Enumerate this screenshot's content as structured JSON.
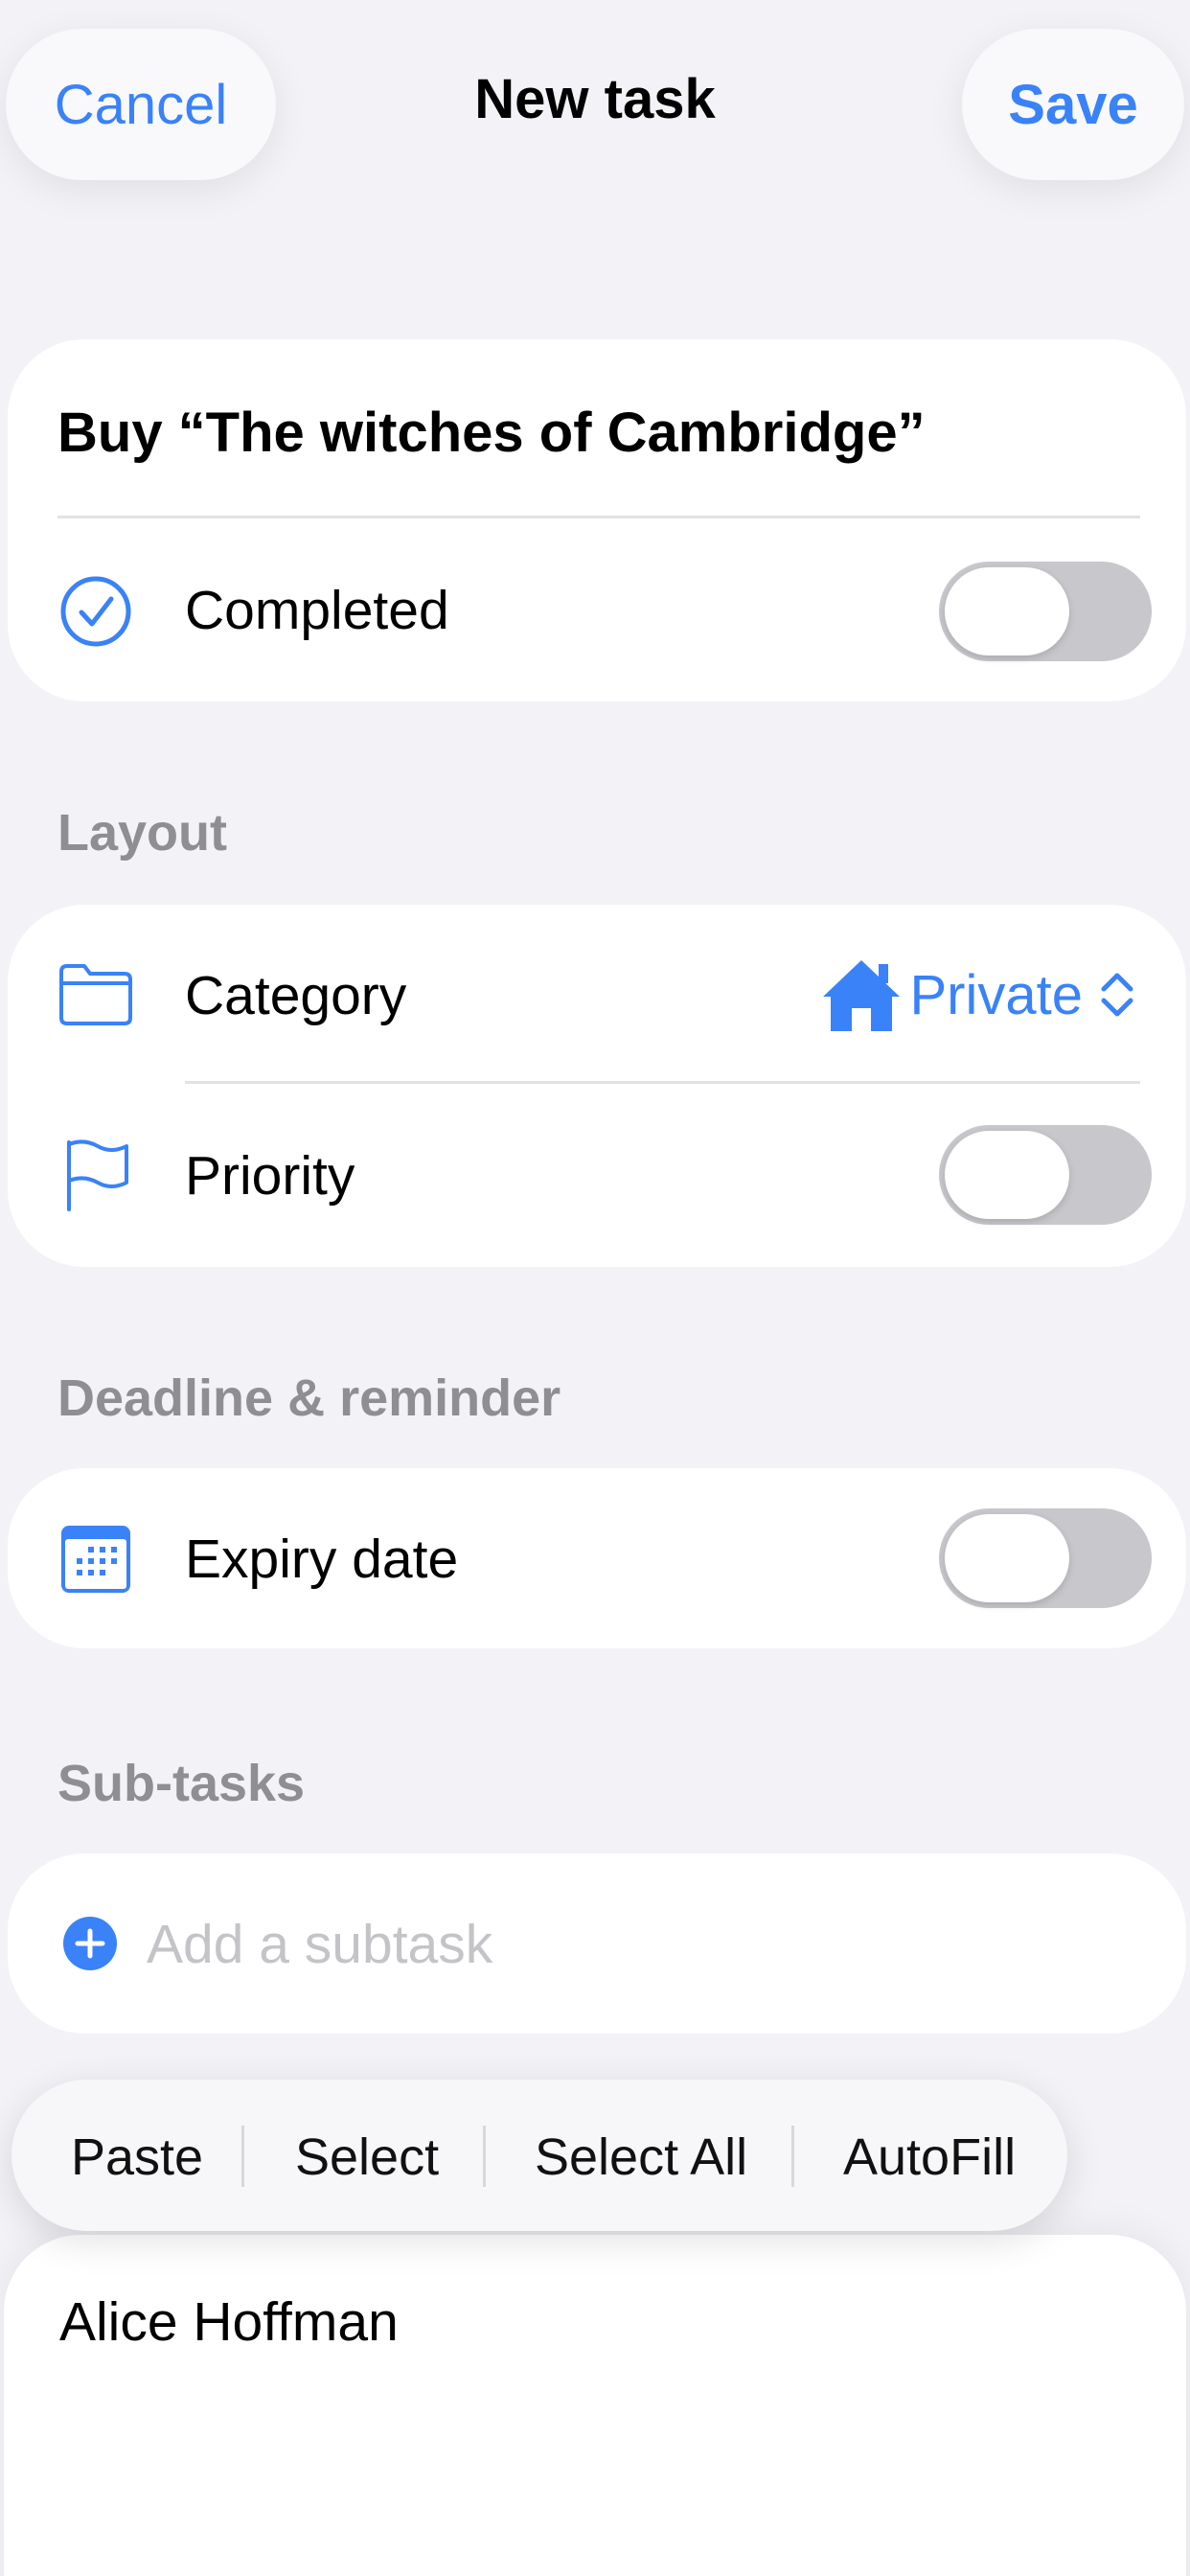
{
  "nav": {
    "cancel_label": "Cancel",
    "title": "New task",
    "save_label": "Save"
  },
  "task": {
    "title": "Buy “The witches of Cambridge”",
    "completed_label": "Completed",
    "completed_on": false
  },
  "layout_section": {
    "header": "Layout",
    "category_label": "Category",
    "category_value": "Private",
    "priority_label": "Priority",
    "priority_on": false
  },
  "deadline_section": {
    "header": "Deadline & reminder",
    "expiry_label": "Expiry date",
    "expiry_on": false
  },
  "subtasks_section": {
    "header": "Sub-tasks",
    "add_placeholder": "Add a subtask"
  },
  "edit_menu": {
    "items": [
      "Paste",
      "Select",
      "Select All",
      "AutoFill"
    ]
  },
  "notes": {
    "text": "Alice Hoffman"
  },
  "colors": {
    "accent": "#3a82f7",
    "background": "#f2f2f7",
    "toggle_off": "#c7c7cc"
  },
  "icons": {
    "completed": "checkmark-circle-icon",
    "category": "folder-icon",
    "priority": "flag-icon",
    "expiry": "calendar-icon",
    "category_value": "house-icon",
    "picker": "chevron-up-down-icon",
    "add": "plus-circle-icon"
  }
}
